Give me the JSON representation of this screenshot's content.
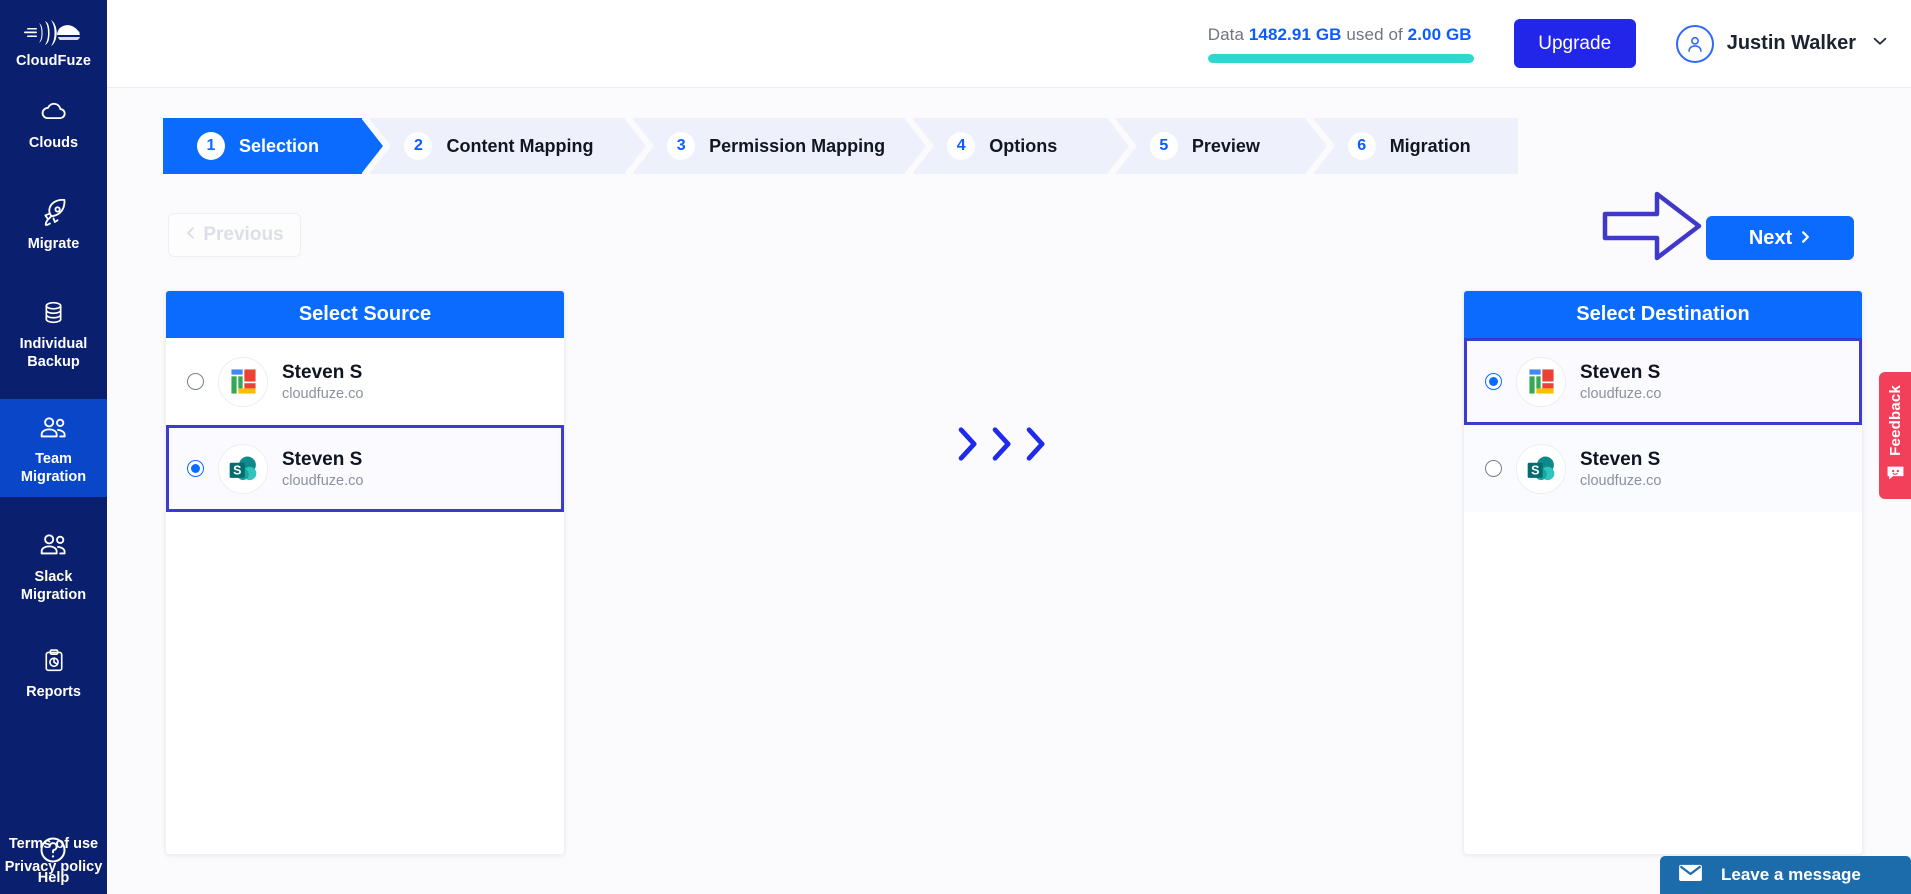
{
  "brand": {
    "name": "CloudFuze",
    "logo_icon": "cloudfuze-logo-icon"
  },
  "sidebar": {
    "items": [
      {
        "label": "Clouds",
        "icon": "cloud-icon",
        "active": false
      },
      {
        "label": "Migrate",
        "icon": "rocket-icon",
        "active": false
      },
      {
        "label": "Individual\nBackup",
        "line1": "Individual",
        "line2": "Backup",
        "icon": "database-stack-icon",
        "active": false
      },
      {
        "label": "Team\nMigration",
        "line1": "Team",
        "line2": "Migration",
        "icon": "people-icon",
        "active": true
      },
      {
        "label": "Slack\nMigration",
        "line1": "Slack",
        "line2": "Migration",
        "icon": "people-icon",
        "active": false
      },
      {
        "label": "Reports",
        "icon": "clipboard-chart-icon",
        "active": false
      }
    ],
    "help": {
      "label": "Help",
      "icon": "question-circle-icon"
    },
    "legal": {
      "terms": "Terms of use",
      "privacy": "Privacy policy"
    }
  },
  "header": {
    "data_label": "Data",
    "data_used": "1482.91 GB",
    "data_mid": "used of",
    "data_total": "2.00 GB",
    "progress_percent": 100,
    "progress_color": "#2bd9ce",
    "upgrade_label": "Upgrade",
    "user_name": "Justin Walker",
    "avatar_icon": "user-avatar-icon",
    "caret_icon": "chevron-down-icon"
  },
  "stepper": {
    "steps": [
      {
        "num": "1",
        "label": "Selection",
        "active": true
      },
      {
        "num": "2",
        "label": "Content Mapping",
        "active": false
      },
      {
        "num": "3",
        "label": "Permission Mapping",
        "active": false
      },
      {
        "num": "4",
        "label": "Options",
        "active": false
      },
      {
        "num": "5",
        "label": "Preview",
        "active": false
      },
      {
        "num": "6",
        "label": "Migration",
        "active": false
      }
    ]
  },
  "nav": {
    "previous_label": "Previous",
    "previous_disabled": true,
    "next_label": "Next",
    "prev_icon": "chevron-left-icon",
    "next_icon": "chevron-right-icon",
    "hint_arrow_icon": "right-arrow-annotation-icon",
    "hint_arrow_color": "#4038cc"
  },
  "source_panel": {
    "title": "Select Source",
    "accounts": [
      {
        "name": "Steven S",
        "domain": "cloudfuze.co",
        "icon": "google-workspace-icon",
        "selected": false,
        "highlighted": false
      },
      {
        "name": "Steven S",
        "domain": "cloudfuze.co",
        "icon": "sharepoint-icon",
        "selected": true,
        "highlighted": true
      }
    ]
  },
  "destination_panel": {
    "title": "Select Destination",
    "accounts": [
      {
        "name": "Steven S",
        "domain": "cloudfuze.co",
        "icon": "google-workspace-icon",
        "selected": true,
        "highlighted": true
      },
      {
        "name": "Steven S",
        "domain": "cloudfuze.co",
        "icon": "sharepoint-icon",
        "selected": false,
        "highlighted": false
      }
    ]
  },
  "center": {
    "chevron_icon": "chevron-right-icon",
    "chevron_count": 3,
    "color": "#1f2aeb"
  },
  "feedback": {
    "label": "Feedback",
    "icon": "smiley-chat-icon",
    "color": "#f2405a"
  },
  "chat_widget": {
    "label": "Leave a message",
    "icon": "envelope-icon",
    "color": "#1c6cac"
  },
  "colors": {
    "primary": "#0b6bff",
    "sidebar": "#0a1f6e",
    "sidebar_active": "#0a46c8",
    "accent_purple": "#3b3bcf"
  }
}
